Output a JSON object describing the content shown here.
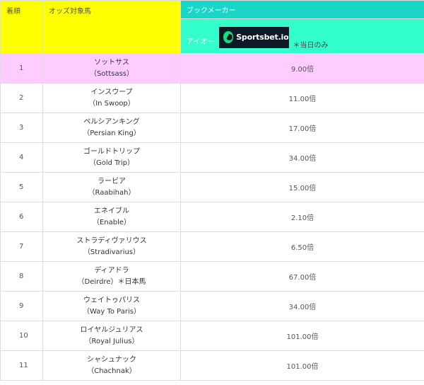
{
  "headers": {
    "rank": "着順",
    "horse": "オッズ対象馬",
    "bookmaker": "ブックメーカー",
    "book_label": "アイオー",
    "book_logo_text": "Sportsbet.io",
    "book_note": "＊当日のみ"
  },
  "colors": {
    "header_yellow": "#ffff00",
    "header_teal": "#1ad6c6",
    "header_mint": "#33ffcc",
    "highlight_row": "#ffccff"
  },
  "rows": [
    {
      "rank": "1",
      "name_ja": "ソットサス",
      "name_en": "（Sottsass）",
      "odds": "9.00倍"
    },
    {
      "rank": "2",
      "name_ja": "インスウープ",
      "name_en": "（In Swoop）",
      "odds": "11.00倍"
    },
    {
      "rank": "3",
      "name_ja": "ペルシアンキング",
      "name_en": "（Persian King）",
      "odds": "17.00倍"
    },
    {
      "rank": "4",
      "name_ja": "ゴールドトリップ",
      "name_en": "（Gold Trip）",
      "odds": "34.00倍"
    },
    {
      "rank": "5",
      "name_ja": "ラービア",
      "name_en": "（Raabihah）",
      "odds": "15.00倍"
    },
    {
      "rank": "6",
      "name_ja": "エネイブル",
      "name_en": "（Enable）",
      "odds": "2.10倍"
    },
    {
      "rank": "7",
      "name_ja": "ストラディヴァリウス",
      "name_en": "（Stradivarius）",
      "odds": "6.50倍"
    },
    {
      "rank": "8",
      "name_ja": "ディアドラ",
      "name_en": "（Deirdre）＊日本馬",
      "odds": "67.00倍"
    },
    {
      "rank": "9",
      "name_ja": "ウェイトゥパリス",
      "name_en": "（Way To Paris）",
      "odds": "34.00倍"
    },
    {
      "rank": "10",
      "name_ja": "ロイヤルジュリアス",
      "name_en": "（Royal Julius）",
      "odds": "101.00倍"
    },
    {
      "rank": "11",
      "name_ja": "シャシュナック",
      "name_en": "（Chachnak）",
      "odds": "101.00倍"
    }
  ]
}
